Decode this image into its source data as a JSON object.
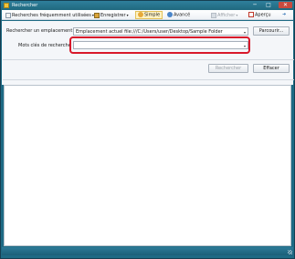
{
  "window": {
    "title": "Rechercher",
    "minimize_glyph": "─",
    "maximize_glyph": "□",
    "close_glyph": "✕"
  },
  "toolbar": {
    "frequent_label": "Recherches fréquemment utilisées",
    "save_label": "Enregistrer",
    "simple_label": "Simple",
    "advanced_label": "Avancé",
    "display_label": "Afficher",
    "preview_label": "Aperçu",
    "caret": "▾",
    "pin_glyph": "➜"
  },
  "form": {
    "location_label": "Rechercher un emplacement :",
    "location_value": "Emplacement actuel file:///C:/Users/user/Desktop/Sample Folder",
    "browse_label": "Parcourir...",
    "keywords_label": "Mots clés de recherche :",
    "keywords_value": "",
    "search_label": "Rechercher",
    "clear_label": "Effacer",
    "dropdown_arrow": "▾"
  },
  "colors": {
    "title_bar": "#20697f",
    "highlight": "#d8182a",
    "status_bar": "#1c5f78"
  }
}
